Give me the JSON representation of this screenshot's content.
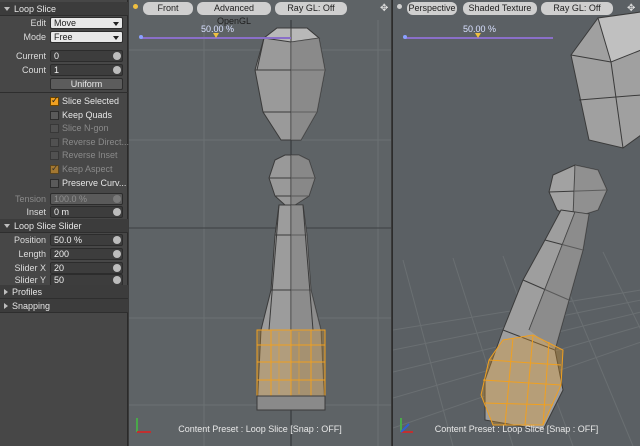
{
  "panel": {
    "loop_slice_header": "Loop Slice",
    "edit_label": "Edit",
    "edit_value": "Move",
    "mode_label": "Mode",
    "mode_value": "Free",
    "current_label": "Current",
    "current_value": "0",
    "count_label": "Count",
    "count_value": "1",
    "uniform_label": "Uniform",
    "checkboxes": [
      {
        "label": "Slice Selected",
        "checked": true,
        "enabled": true
      },
      {
        "label": "Keep Quads",
        "checked": false,
        "enabled": true
      },
      {
        "label": "Slice N-gon",
        "checked": false,
        "enabled": false
      },
      {
        "label": "Reverse Direct...",
        "checked": false,
        "enabled": false
      },
      {
        "label": "Reverse Inset",
        "checked": false,
        "enabled": false
      },
      {
        "label": "Keep Aspect",
        "checked": true,
        "enabled": false
      },
      {
        "label": "Preserve Curv...",
        "checked": false,
        "enabled": true
      }
    ],
    "tension_label": "Tension",
    "tension_value": "100.0 %",
    "inset_label": "Inset",
    "inset_value": "0 m",
    "slider_header": "Loop Slice Slider",
    "position_label": "Position",
    "position_value": "50.0 %",
    "length_label": "Length",
    "length_value": "200",
    "sliderx_label": "Slider X",
    "sliderx_value": "20",
    "slidery_label": "Slider Y",
    "slidery_value": "50",
    "profiles_header": "Profiles",
    "snapping_header": "Snapping"
  },
  "viewport_front": {
    "view_button": "Front",
    "shading_button": "Advanced OpenGL",
    "ray_button": "Ray GL: Off",
    "slider_percent": "50.00 %",
    "status": "Content Preset : Loop Slice  [Snap : OFF]"
  },
  "viewport_persp": {
    "view_button": "Perspective",
    "shading_button": "Shaded Texture",
    "ray_button": "Ray GL: Off",
    "slider_percent": "50.00 %",
    "status": "Content Preset : Loop Slice  [Snap : OFF]"
  },
  "colors": {
    "selection": "#f0a020",
    "slider_line": "#8a6fc8",
    "viewport_bg": "#5e6366"
  }
}
